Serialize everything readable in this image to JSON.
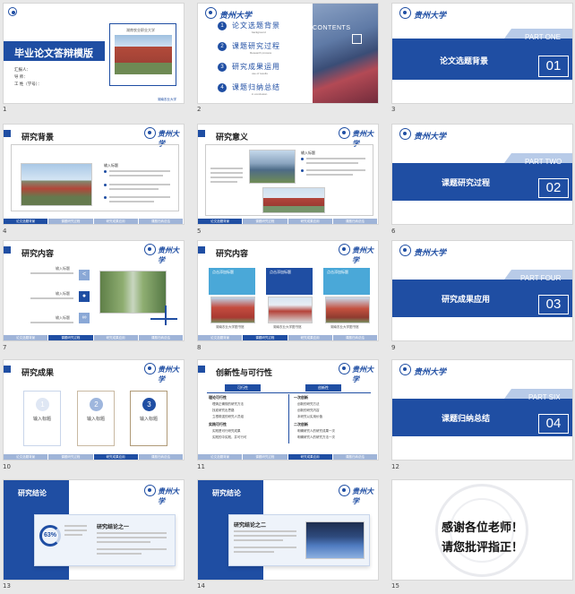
{
  "slides": {
    "s1": {
      "num": "1",
      "title": "毕业论文答辩模版",
      "photo_caption": "湖南农业职业大学",
      "reporter": "汇报人：",
      "tutor": "导  师：",
      "work_no": "工 姓（学号）：",
      "footer": "湖南农业大学"
    },
    "s2": {
      "num": "2",
      "contents_label": "CONTENTS",
      "items": [
        {
          "n": "1",
          "label": "论文选题背景",
          "sub": "background"
        },
        {
          "n": "2",
          "label": "课题研究过程",
          "sub": "Research process"
        },
        {
          "n": "3",
          "label": "研究成果运用",
          "sub": "use of results"
        },
        {
          "n": "4",
          "label": "课题归纳总结",
          "sub": "in conclusion"
        }
      ]
    },
    "s3": {
      "num": "3",
      "part": "PART ONE",
      "title": "论文选题背景",
      "index": "01"
    },
    "s4": {
      "num": "4",
      "title": "研究背景",
      "bullet_head": "输入标题"
    },
    "s5": {
      "num": "5",
      "title": "研究意义",
      "bullet_head": "输入标题"
    },
    "s6": {
      "num": "6",
      "part": "PART TWO",
      "title": "课题研究过程",
      "index": "02"
    },
    "s7": {
      "num": "7",
      "title": "研究内容",
      "labels": [
        "输入标题",
        "输入标题",
        "输入标题"
      ]
    },
    "s8": {
      "num": "8",
      "title": "研究内容",
      "cards": [
        "点击添加标题",
        "点击添加标题",
        "点击添加标题"
      ],
      "captions": [
        "湖南农业大学图书馆",
        "湖南农业大学图书馆",
        "湖南农业大学图书馆"
      ]
    },
    "s9": {
      "num": "9",
      "part": "PART FOUR",
      "title": "研究成果应用",
      "index": "03"
    },
    "s10": {
      "num": "10",
      "title": "研究成果",
      "steps": [
        {
          "n": "1",
          "label": "输入标题"
        },
        {
          "n": "2",
          "label": "输入标题"
        },
        {
          "n": "3",
          "label": "输入标题"
        }
      ]
    },
    "s11": {
      "num": "11",
      "title": "创新性与可行性",
      "col_a": "可行性",
      "col_b": "创新性",
      "left_head": "理论可行性",
      "left_head2": "实践可行性",
      "left_items": [
        "理清正确规的研究方法",
        "找准研究出思路",
        "立根筑强的研究人员组",
        "实践是可行研究成果",
        "实践的中实践，并可行可"
      ],
      "right_head": "一次创新",
      "right_head2": "二次创新",
      "right_items": [
        "创新的研究方法",
        "创新的研究内容",
        "本研究以实用价值",
        "明确研究人的研究成果一次",
        "明确研究人的研究方法一次"
      ]
    },
    "s12": {
      "num": "12",
      "part": "PART SIX",
      "title": "课题归纳总结",
      "index": "04"
    },
    "s13": {
      "num": "13",
      "title": "研究结论",
      "percent": "63%",
      "card_title": "研究结论之一"
    },
    "s14": {
      "num": "14",
      "title": "研究结论",
      "card_title": "研究结论之二"
    },
    "s15": {
      "num": "15",
      "thanks_1": "感谢各位老师！",
      "thanks_2": "请您批评指正！"
    }
  },
  "tabs": [
    "论文选题背景",
    "课题研究过程",
    "研究成果应用",
    "课题归纳总结"
  ],
  "logo_text": "贵州大学",
  "colors": {
    "primary": "#1f4ea3",
    "light": "#b8cbe8"
  }
}
